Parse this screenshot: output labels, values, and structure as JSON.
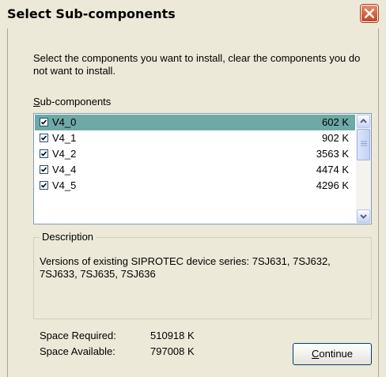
{
  "window": {
    "title": "Select Sub-components"
  },
  "instructions": "Select the components you want to install, clear the components you do not want to install.",
  "subcomponents": {
    "label_first": "S",
    "label_rest": "ub-components",
    "items": [
      {
        "name": "V4_0",
        "size": "602 K",
        "checked": true,
        "selected": true
      },
      {
        "name": "V4_1",
        "size": "902 K",
        "checked": true,
        "selected": false
      },
      {
        "name": "V4_2",
        "size": "3563 K",
        "checked": true,
        "selected": false
      },
      {
        "name": "V4_4",
        "size": "4474 K",
        "checked": true,
        "selected": false
      },
      {
        "name": "V4_5",
        "size": "4296 K",
        "checked": true,
        "selected": false
      }
    ]
  },
  "description": {
    "title": "Description",
    "text": "Versions of existing SIPROTEC device series: 7SJ631, 7SJ632, 7SJ633, 7SJ635, 7SJ636"
  },
  "space": {
    "required_label": "Space Required:",
    "required_value": "510918 K",
    "available_label": "Space Available:",
    "available_value": "797008 K"
  },
  "buttons": {
    "continue_first": "C",
    "continue_rest": "ontinue"
  },
  "icons": {
    "close": "close-icon",
    "check": "checkmark-icon",
    "scroll_up": "chevron-up-icon",
    "scroll_down": "chevron-down-icon"
  },
  "colors": {
    "dialog_bg": "#ece9d8",
    "selection": "#6ea9a6",
    "close_button": "#c8461f",
    "button_border": "#003c74"
  }
}
